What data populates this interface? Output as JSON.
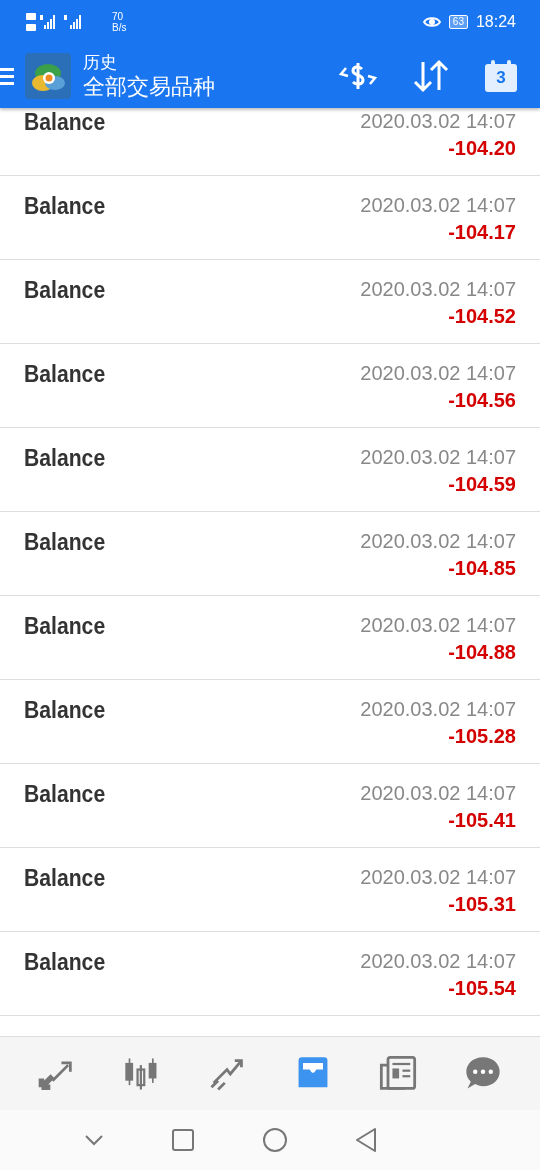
{
  "status_bar": {
    "speed_value": "70",
    "speed_unit": "B/s",
    "battery": "63",
    "time": "18:24"
  },
  "app_bar": {
    "title": "历史",
    "subtitle": "全部交易品种",
    "calendar_day": "3"
  },
  "rows": [
    {
      "label": "Balance",
      "time": "2020.03.02 14:07",
      "amount": "-104.20"
    },
    {
      "label": "Balance",
      "time": "2020.03.02 14:07",
      "amount": "-104.17"
    },
    {
      "label": "Balance",
      "time": "2020.03.02 14:07",
      "amount": "-104.52"
    },
    {
      "label": "Balance",
      "time": "2020.03.02 14:07",
      "amount": "-104.56"
    },
    {
      "label": "Balance",
      "time": "2020.03.02 14:07",
      "amount": "-104.59"
    },
    {
      "label": "Balance",
      "time": "2020.03.02 14:07",
      "amount": "-104.85"
    },
    {
      "label": "Balance",
      "time": "2020.03.02 14:07",
      "amount": "-104.88"
    },
    {
      "label": "Balance",
      "time": "2020.03.02 14:07",
      "amount": "-105.28"
    },
    {
      "label": "Balance",
      "time": "2020.03.02 14:07",
      "amount": "-105.41"
    },
    {
      "label": "Balance",
      "time": "2020.03.02 14:07",
      "amount": "-105.31"
    },
    {
      "label": "Balance",
      "time": "2020.03.02 14:07",
      "amount": "-105.54"
    }
  ],
  "bottom_nav": [
    {
      "kind": "trade",
      "selected": false
    },
    {
      "kind": "quotes",
      "selected": false
    },
    {
      "kind": "chart",
      "selected": false
    },
    {
      "kind": "history",
      "selected": true
    },
    {
      "kind": "news",
      "selected": false
    },
    {
      "kind": "chat",
      "selected": false
    }
  ]
}
